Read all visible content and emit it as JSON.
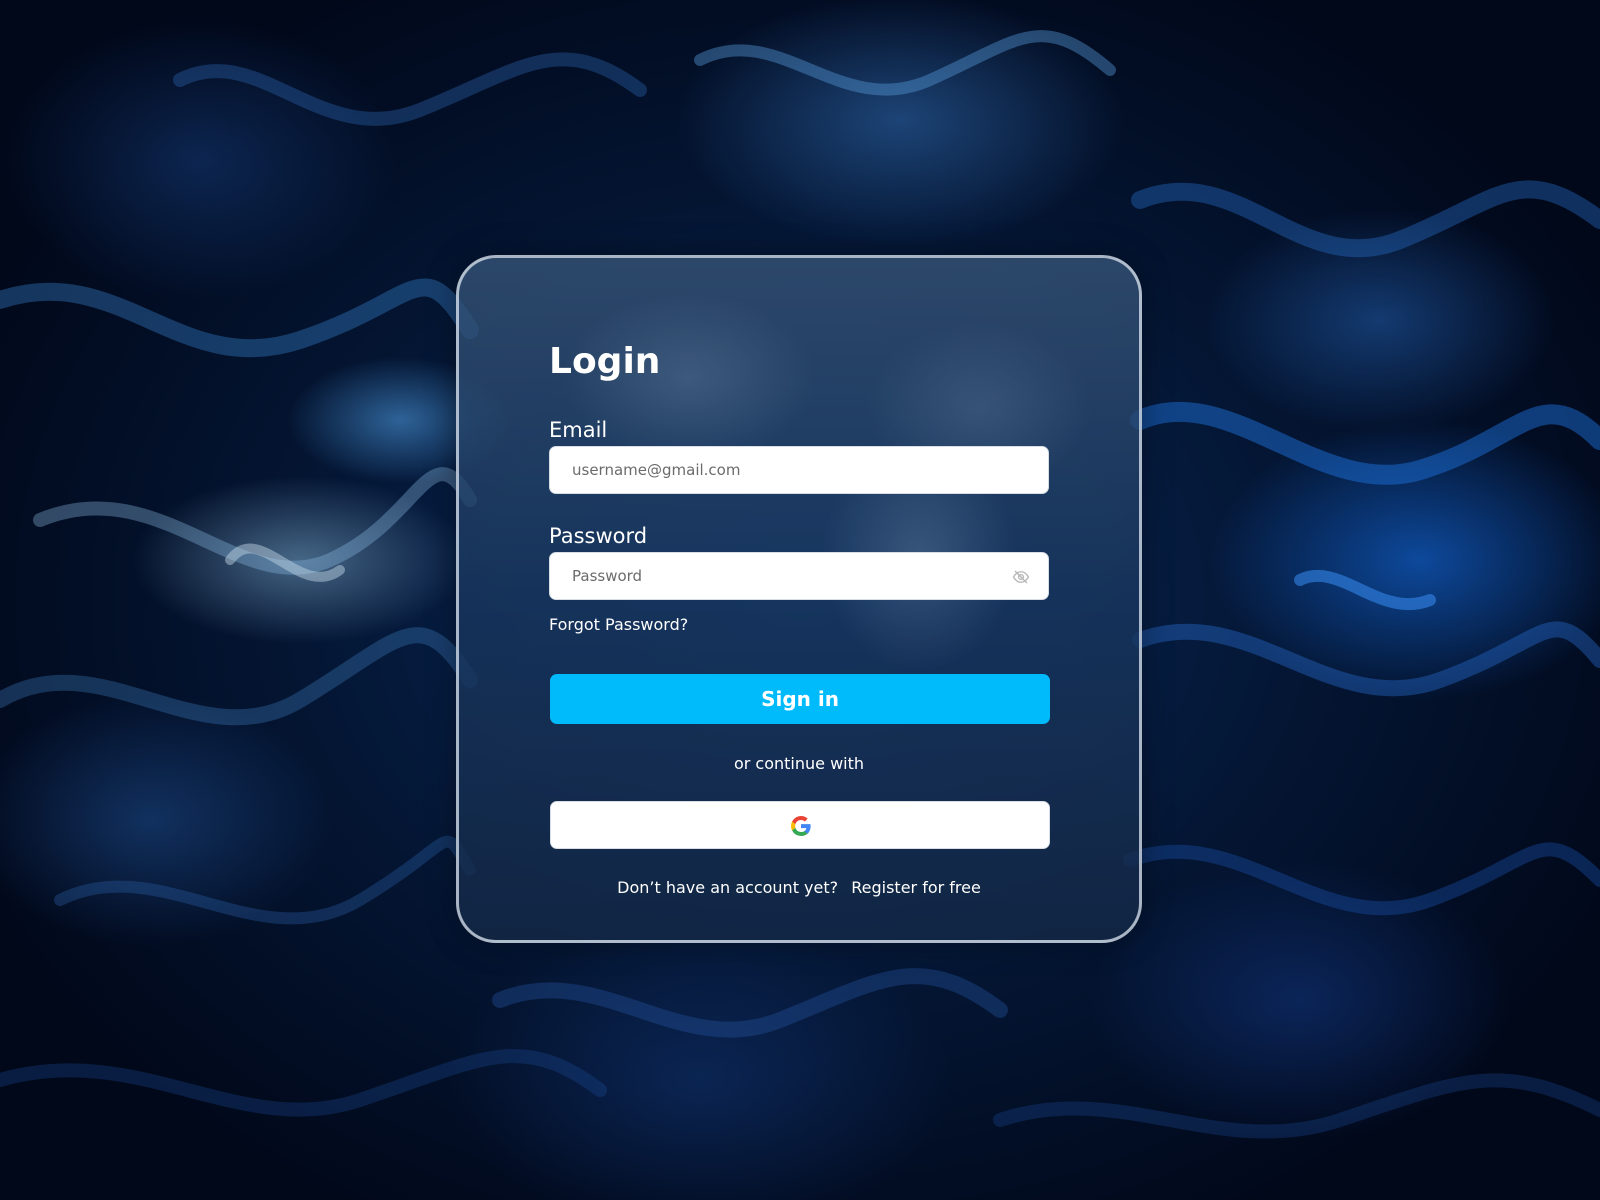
{
  "login": {
    "title": "Login",
    "email": {
      "label": "Email",
      "placeholder": "username@gmail.com",
      "value": ""
    },
    "password": {
      "label": "Password",
      "placeholder": "Password",
      "value": "",
      "toggle_icon": "eye-slash-icon"
    },
    "forgot_password": "Forgot Password?",
    "sign_in_label": "Sign in",
    "divider_text": "or continue with",
    "social": {
      "provider_icon": "google-icon"
    },
    "footer": {
      "prompt": "Don’t have an account yet?",
      "register_link": "Register for free"
    }
  },
  "colors": {
    "accent": "#00bbfb",
    "card_border": "#dce6f0",
    "text": "#ffffff",
    "input_bg": "#ffffff",
    "placeholder": "#6b6b6b"
  }
}
